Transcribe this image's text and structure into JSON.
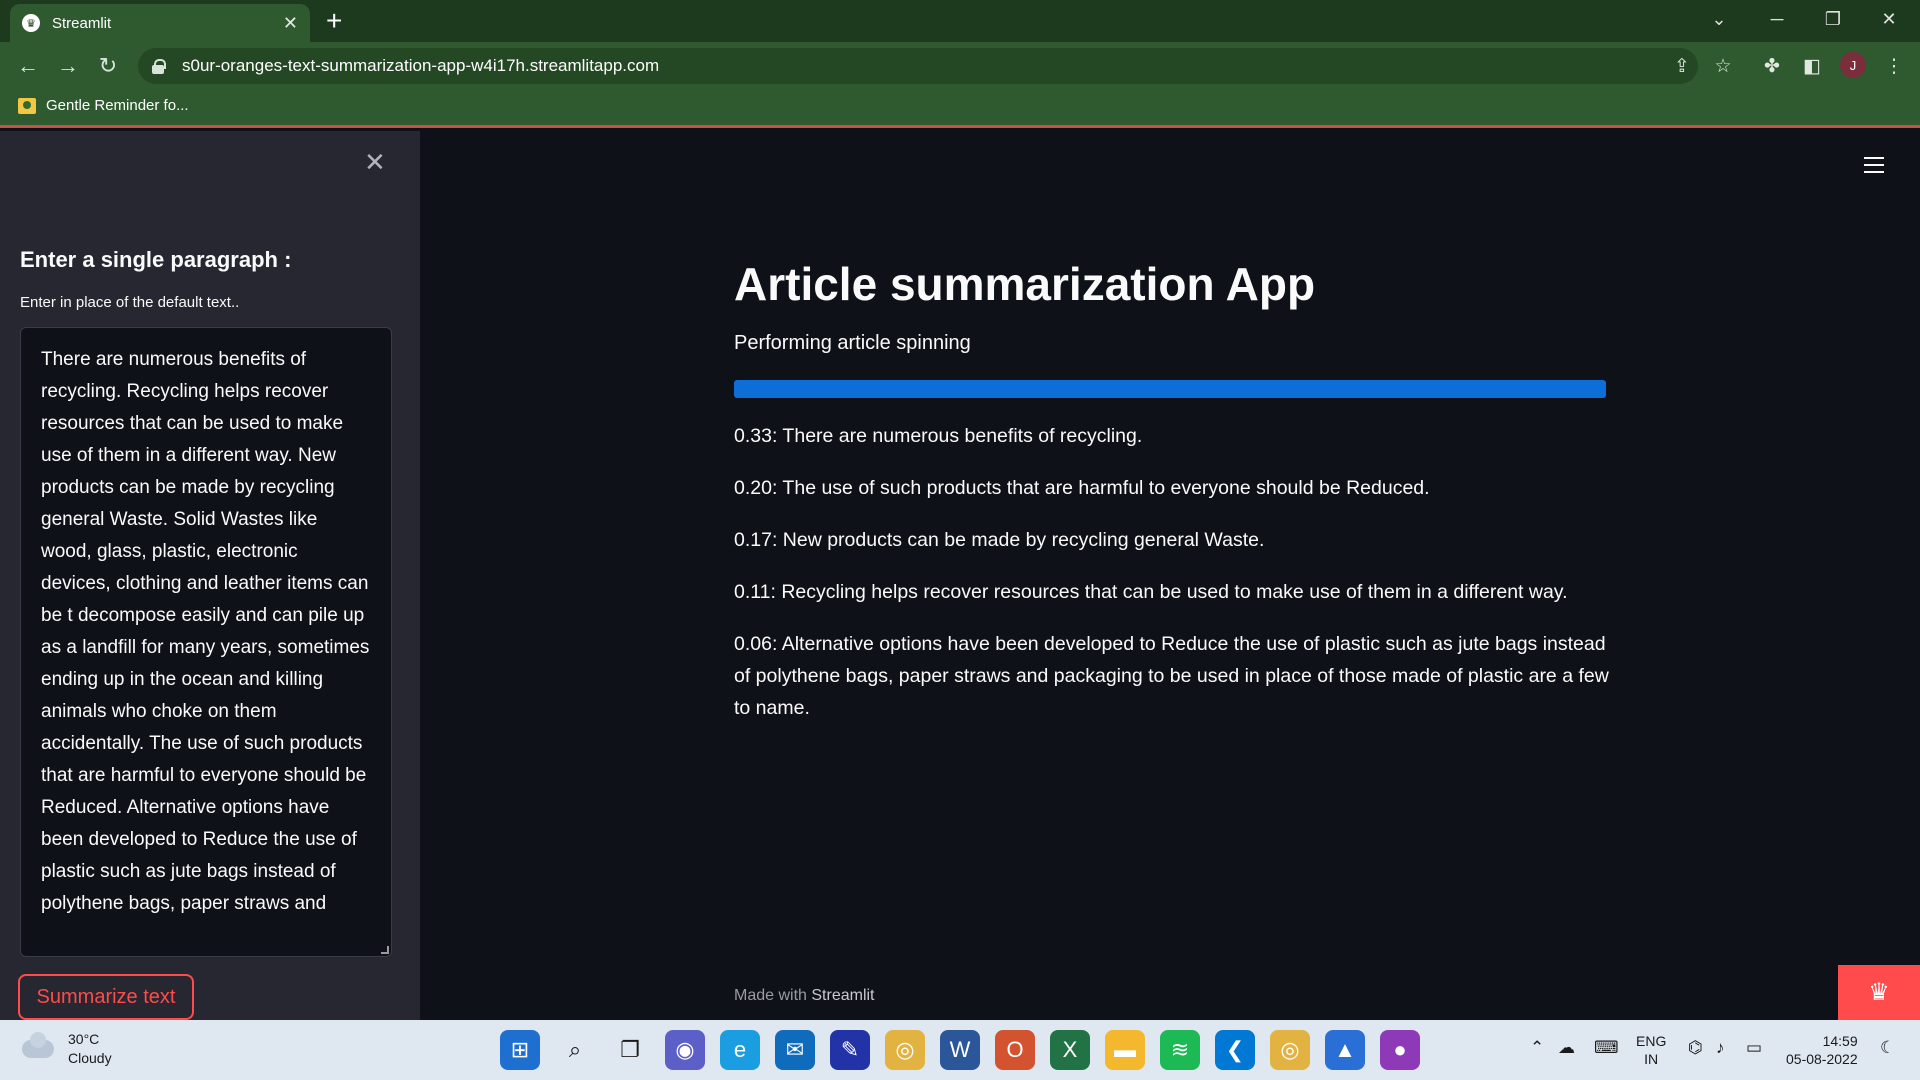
{
  "browser": {
    "tab_title": "Streamlit",
    "url": "s0ur-oranges-text-summarization-app-w4i17h.streamlitapp.com",
    "bookmark": "Gentle Reminder fo...",
    "profile_initial": "J"
  },
  "sidebar": {
    "title": "Enter a single paragraph :",
    "hint": "Enter in place of the default text..",
    "input_text": "There are numerous benefits of recycling. Recycling helps recover resources that can be used to make use of them in a different way. New products can be made by recycling general Waste. Solid Wastes like wood, glass, plastic, electronic devices, clothing and leather items can be t decompose easily and can pile up as a landfill for many years, sometimes ending up in the ocean and killing animals who choke on them accidentally. The use of such products that are harmful to everyone should be Reduced. Alternative options have been developed to Reduce the use of plastic such as jute bags instead of polythene bags, paper straws and",
    "button_label": "Summarize text"
  },
  "main": {
    "title": "Article summarization App",
    "status": "Performing article spinning",
    "progress": 1.0,
    "results": [
      "0.33: There are numerous benefits of recycling.",
      "0.20: The use of such products that are harmful to everyone should be Reduced.",
      "0.17: New products can be made by recycling general Waste.",
      "0.11: Recycling helps recover resources that can be used to make use of them in a different way.",
      "0.06: Alternative options have been developed to Reduce the use of plastic such as jute bags instead of polythene bags, paper straws and packaging to be used in place of those made of plastic are a few to name."
    ],
    "footer_prefix": "Made with",
    "footer_brand": "Streamlit"
  },
  "taskbar": {
    "temperature": "30°C",
    "weather": "Cloudy",
    "lang_1": "ENG",
    "lang_2": "IN",
    "time": "14:59",
    "date": "05-08-2022"
  },
  "colors": {
    "accent": "#ff4b4b",
    "progress": "#0d6ed8",
    "browser_green": "#2f5a2f"
  }
}
